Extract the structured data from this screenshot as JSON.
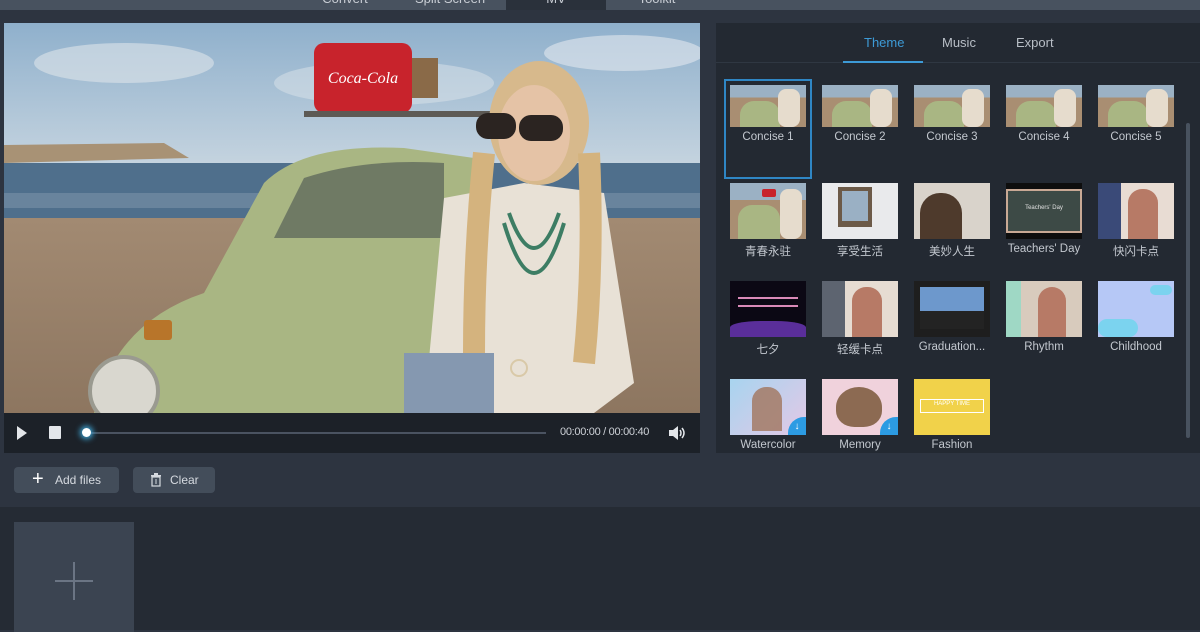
{
  "app": {
    "top_tabs": [
      {
        "label": "Convert",
        "active": false
      },
      {
        "label": "Split Screen",
        "active": false
      },
      {
        "label": "MV",
        "active": true
      },
      {
        "label": "Toolkit",
        "active": false
      }
    ]
  },
  "player": {
    "preview_description": "Woman with braided hair and sunglasses leaning on a green vintage car at the beach",
    "roof_box_text": "Coca-Cola",
    "current_time": "00:00:00",
    "separator": "/",
    "total_time": "00:00:40",
    "time_display": "00:00:00 / 00:00:40",
    "progress": 0
  },
  "panel": {
    "tabs": [
      {
        "label": "Theme",
        "active": true
      },
      {
        "label": "Music",
        "active": false
      },
      {
        "label": "Export",
        "active": false
      }
    ],
    "themes": [
      {
        "label": "Concise 1",
        "selected": true,
        "download": false
      },
      {
        "label": "Concise 2",
        "selected": false,
        "download": false
      },
      {
        "label": "Concise 3",
        "selected": false,
        "download": false
      },
      {
        "label": "Concise 4",
        "selected": false,
        "download": false
      },
      {
        "label": "Concise 5",
        "selected": false,
        "download": false
      },
      {
        "label": "青春永驻",
        "selected": false,
        "download": false
      },
      {
        "label": "享受生活",
        "selected": false,
        "download": false
      },
      {
        "label": "美妙人生",
        "selected": false,
        "download": false
      },
      {
        "label": "Teachers' Day",
        "selected": false,
        "download": false
      },
      {
        "label": "快闪卡点",
        "selected": false,
        "download": false
      },
      {
        "label": "七夕",
        "selected": false,
        "download": false
      },
      {
        "label": "轻缓卡点",
        "selected": false,
        "download": false
      },
      {
        "label": "Graduation...",
        "selected": false,
        "download": false
      },
      {
        "label": "Rhythm",
        "selected": false,
        "download": false
      },
      {
        "label": "Childhood",
        "selected": false,
        "download": false
      },
      {
        "label": "Watercolor",
        "selected": false,
        "download": true
      },
      {
        "label": "Memory",
        "selected": false,
        "download": true
      },
      {
        "label": "Fashion",
        "selected": false,
        "download": false
      }
    ],
    "thumb_texts": {
      "teachers_day": "Teachers' Day",
      "fashion": "HAPPY TIME"
    }
  },
  "toolbar": {
    "add_files_label": "Add files",
    "clear_label": "Clear"
  },
  "colors": {
    "accent": "#3d9ad6",
    "background": "#2d3440",
    "panel": "#232932"
  }
}
